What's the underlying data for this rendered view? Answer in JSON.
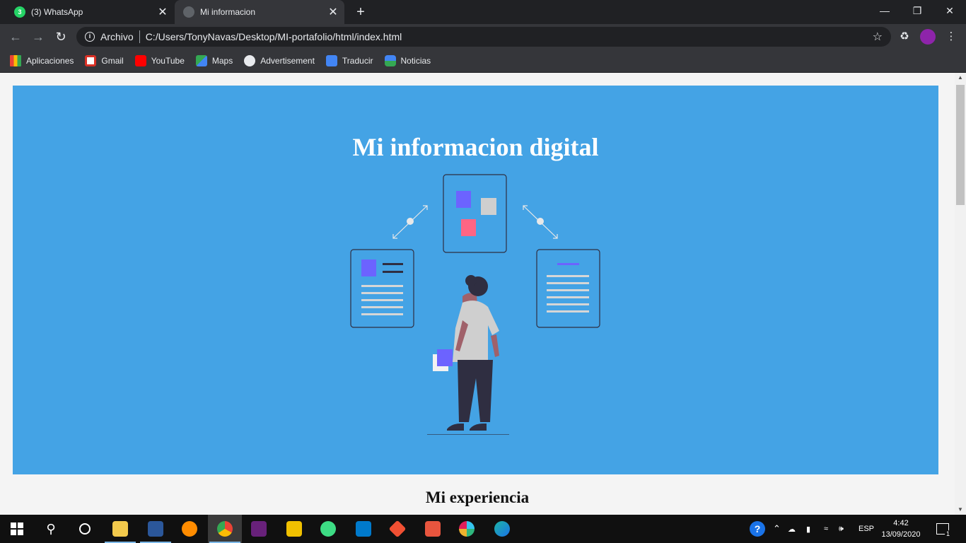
{
  "tabs": [
    {
      "title": "(3) WhatsApp",
      "badge": "3",
      "active": false
    },
    {
      "title": "Mi informacion",
      "active": true
    }
  ],
  "address_bar": {
    "security_label": "Archivo",
    "url": "C:/Users/TonyNavas/Desktop/MI-portafolio/html/index.html"
  },
  "bookmarks": [
    {
      "label": "Aplicaciones",
      "icon": "apps-grid-icon"
    },
    {
      "label": "Gmail",
      "icon": "gmail-icon"
    },
    {
      "label": "YouTube",
      "icon": "youtube-icon"
    },
    {
      "label": "Maps",
      "icon": "maps-icon"
    },
    {
      "label": "Advertisement",
      "icon": "globe-icon"
    },
    {
      "label": "Traducir",
      "icon": "translate-icon"
    },
    {
      "label": "Noticias",
      "icon": "news-icon"
    }
  ],
  "page": {
    "hero_title": "Mi informacion digital",
    "section_title": "Mi experiencia",
    "hero_color": "#44a3e5"
  },
  "taskbar": {
    "language": "ESP",
    "time": "4:42",
    "date": "13/09/2020",
    "notification_count": "1"
  },
  "colors": {
    "accent_purple": "#6c63ff",
    "accent_pink": "#ff6584"
  }
}
